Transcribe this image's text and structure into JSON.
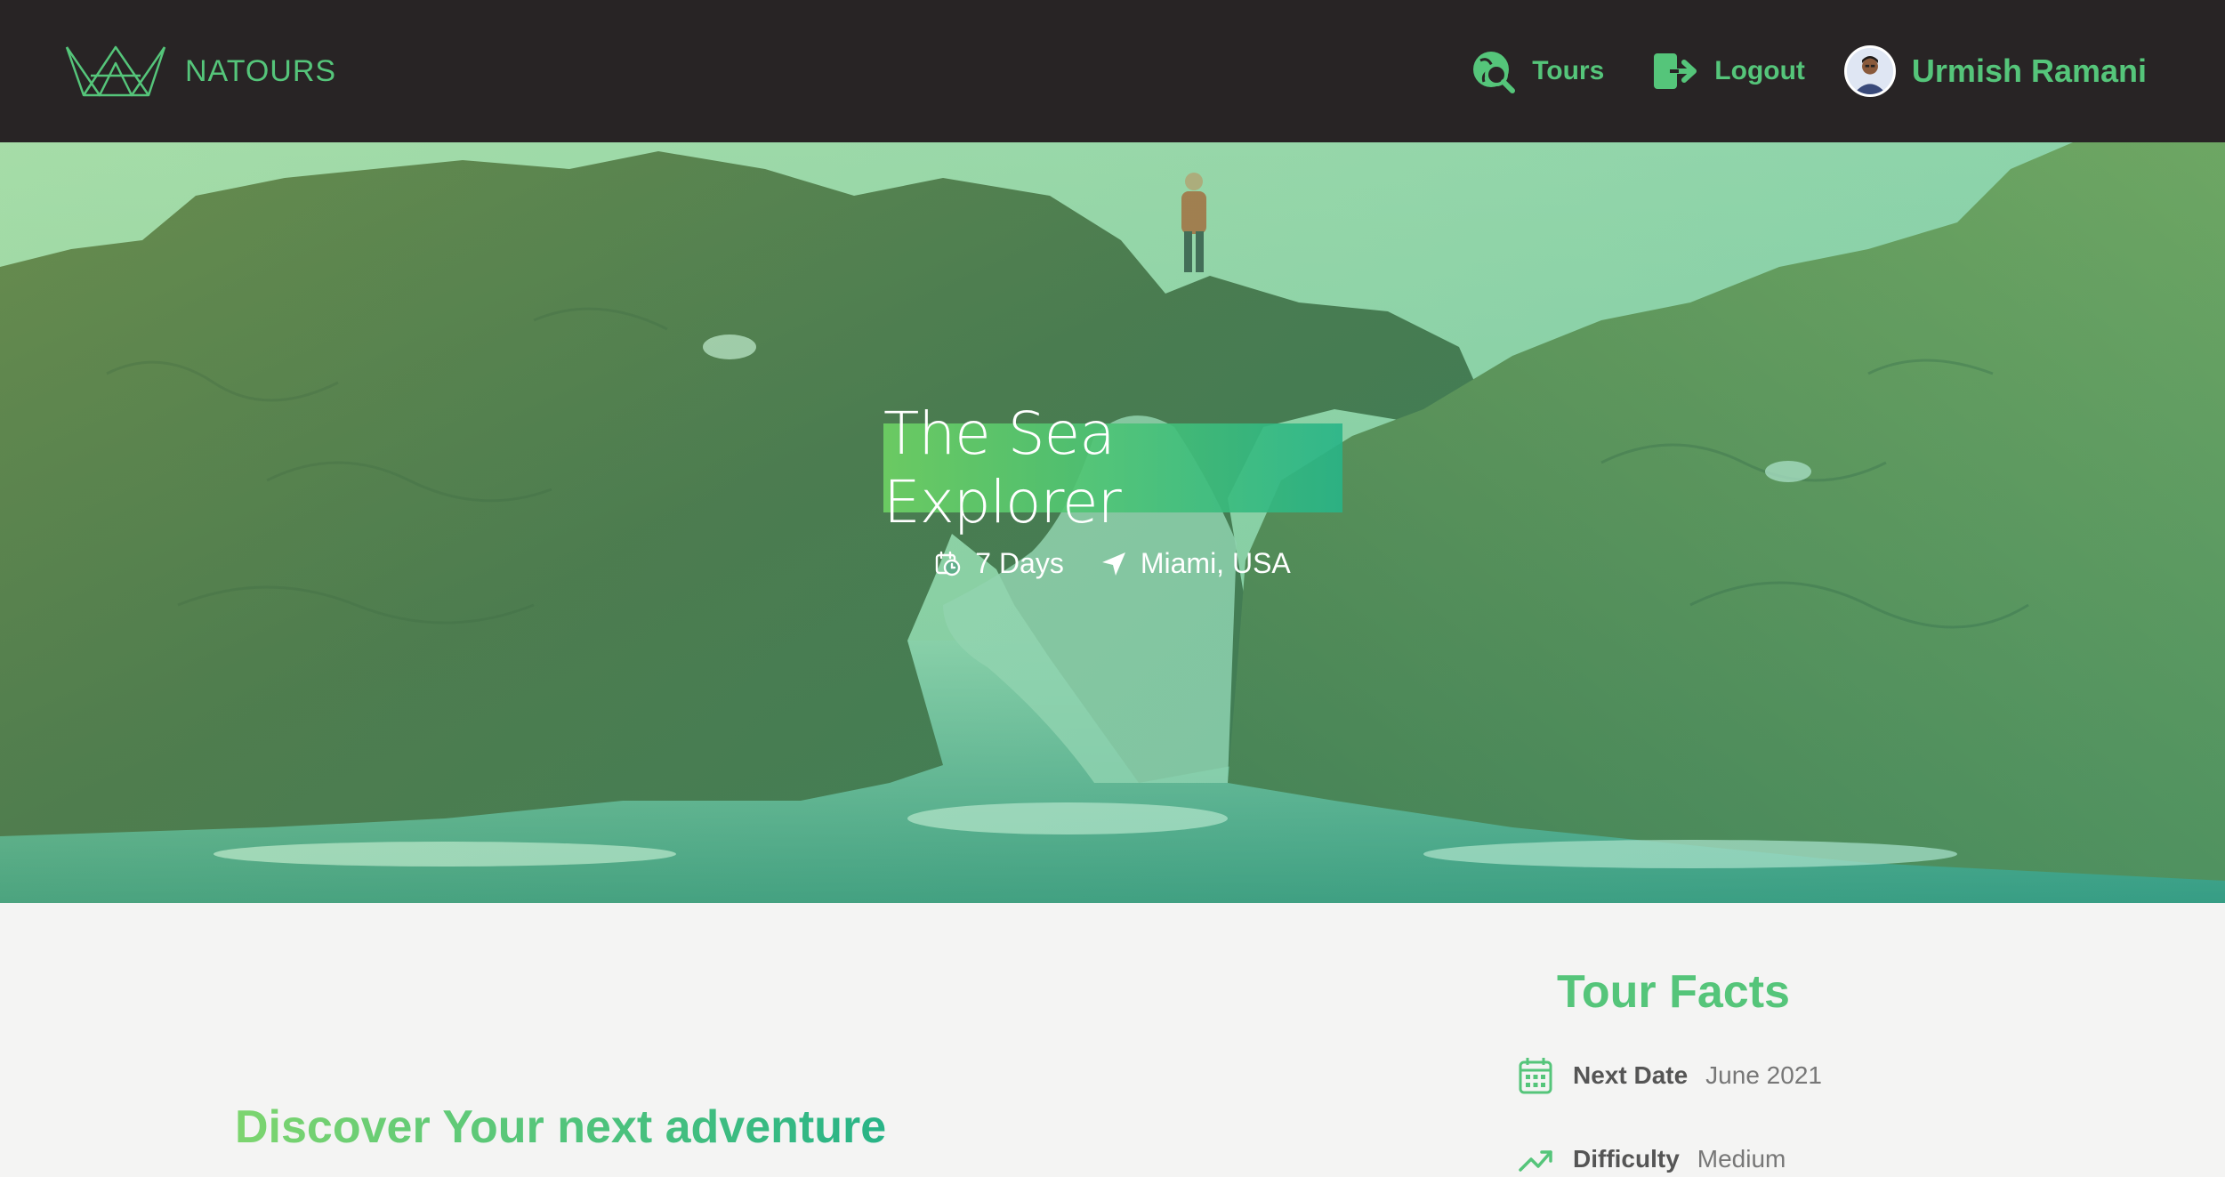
{
  "header": {
    "brand": "NATOURS",
    "nav": [
      {
        "label": "Tours",
        "icon": "map-search-icon"
      },
      {
        "label": "Logout",
        "icon": "logout-icon"
      }
    ],
    "user": {
      "name": "Urmish Ramani",
      "avatar_icon": "user-avatar"
    }
  },
  "hero": {
    "title": "The Sea Explorer",
    "duration": "7 Days",
    "location": "Miami, USA"
  },
  "facts": {
    "title": "Tour Facts",
    "items": [
      {
        "label": "Next Date",
        "value": "June 2021",
        "icon": "calendar-icon"
      },
      {
        "label": "Difficulty",
        "value": "Medium",
        "icon": "trending-up-icon"
      }
    ]
  },
  "about": {
    "heading": "Discover Your next adventure"
  },
  "colors": {
    "primary": "#55c57a",
    "header_bg": "#282425",
    "page_bg": "#f4f4f3"
  }
}
